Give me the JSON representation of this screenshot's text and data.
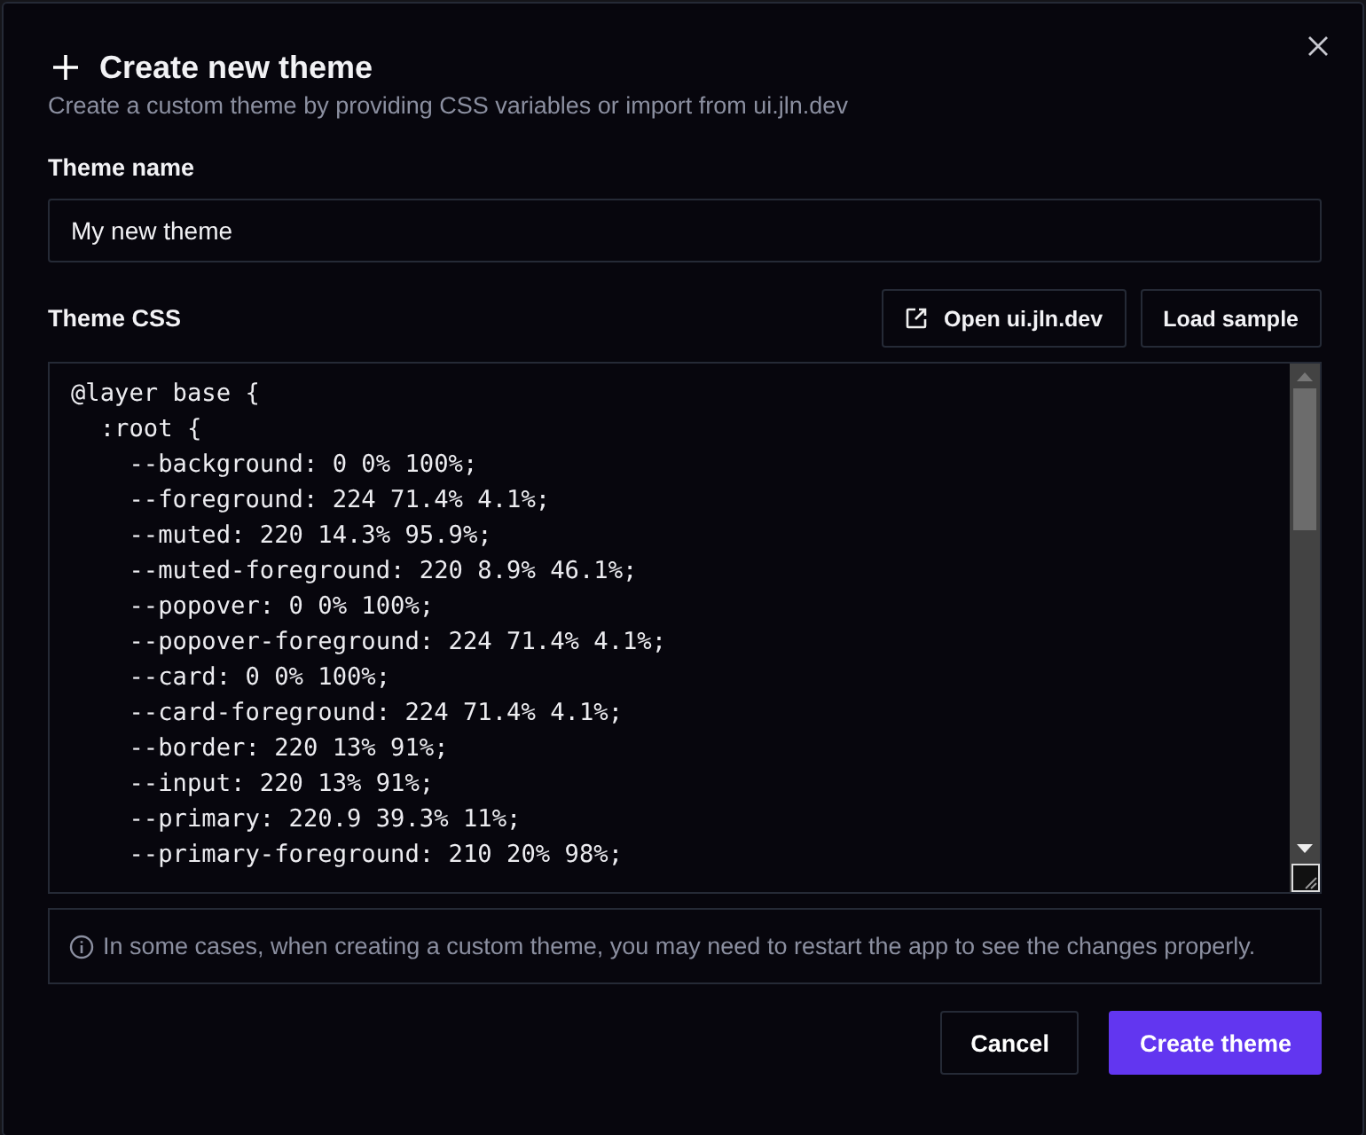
{
  "dialog": {
    "title": "Create new theme",
    "description": "Create a custom theme by providing CSS variables or import from ui.jln.dev"
  },
  "name_field": {
    "label": "Theme name",
    "value": "My new theme"
  },
  "css_field": {
    "label": "Theme CSS",
    "actions": [
      {
        "label": "Open ui.jln.dev",
        "kind": "external"
      },
      {
        "label": "Load sample",
        "kind": "plain"
      }
    ],
    "lines": [
      "@layer base {",
      "  :root {",
      "    --background: 0 0% 100%;",
      "    --foreground: 224 71.4% 4.1%;",
      "    --muted: 220 14.3% 95.9%;",
      "    --muted-foreground: 220 8.9% 46.1%;",
      "    --popover: 0 0% 100%;",
      "    --popover-foreground: 224 71.4% 4.1%;",
      "    --card: 0 0% 100%;",
      "    --card-foreground: 224 71.4% 4.1%;",
      "    --border: 220 13% 91%;",
      "    --input: 220 13% 91%;",
      "    --primary: 220.9 39.3% 11%;",
      "    --primary-foreground: 210 20% 98%;"
    ]
  },
  "note": "In some cases, when creating a custom theme, you may need to restart the app to see the changes properly.",
  "buttons": [
    {
      "label": "Cancel",
      "kind": "secondary"
    },
    {
      "label": "Create theme",
      "kind": "primary"
    }
  ]
}
